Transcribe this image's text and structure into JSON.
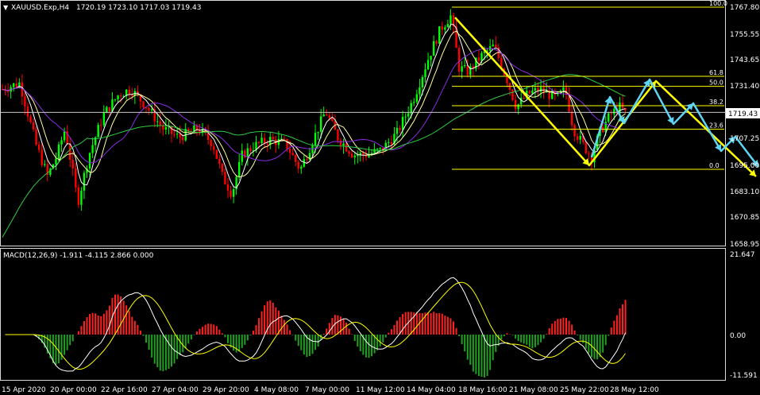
{
  "header": {
    "symbol": "XAUUSD.Exp,H4",
    "ohlc": "1720.19 1723.10 1717.03 1719.43",
    "macd_label": "MACD(12,26,9) -1.911 -4.115 2.866 0.000"
  },
  "current_price": "1719.43",
  "colors": {
    "background": "#000000",
    "bull": "#00ff00",
    "bear": "#ff0000",
    "fib": "#ffff00",
    "projection": "#5fd3f3",
    "arrow": "#ffff00",
    "ma_fast": "#ffffff",
    "ma_medium": "#ffff99",
    "ma_slow": "#8a2be2",
    "ma_long": "#2ecc40",
    "macd_hist_pos": "#ff2020",
    "macd_hist_neg": "#20a020",
    "macd_line": "#ffffff",
    "signal_line": "#ffff00"
  },
  "price_axis": [
    "1767.80",
    "1755.55",
    "1743.65",
    "1731.40",
    "1707.25",
    "1695.00",
    "1683.10",
    "1670.85",
    "1658.95"
  ],
  "macd_axis": [
    "21.647",
    "0.00",
    "-11.591"
  ],
  "time_axis": [
    "15 Apr 2020",
    "20 Apr 00:00",
    "22 Apr 16:00",
    "27 Apr 04:00",
    "29 Apr 20:00",
    "4 May 08:00",
    "7 May 00:00",
    "11 May 12:00",
    "14 May 04:00",
    "18 May 16:00",
    "21 May 08:00",
    "25 May 22:00",
    "28 May 12:00"
  ],
  "fib_levels": [
    {
      "label": "100.0",
      "price": 1767.8
    },
    {
      "label": "61.8",
      "price": 1736.0
    },
    {
      "label": "50.0",
      "price": 1731.4
    },
    {
      "label": "38.2",
      "price": 1722.5
    },
    {
      "label": "23.6",
      "price": 1711.7
    },
    {
      "label": "0.0",
      "price": 1693.3
    }
  ],
  "horizontal_line_price": 1719.43
}
